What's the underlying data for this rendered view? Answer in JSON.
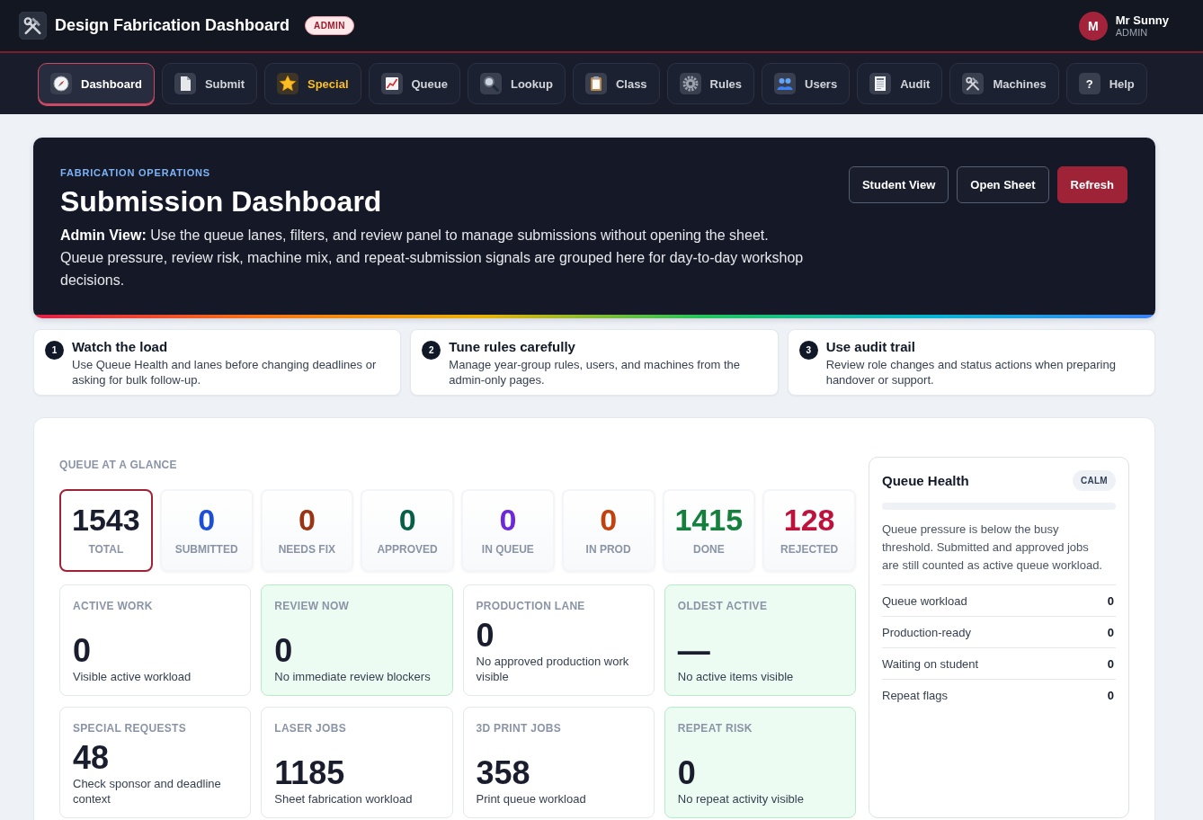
{
  "header": {
    "title": "Design Fabrication Dashboard",
    "badge": "ADMIN",
    "user": {
      "initial": "M",
      "name": "Mr Sunny",
      "role": "ADMIN"
    }
  },
  "nav": [
    {
      "label": "Dashboard",
      "selected": true,
      "highlighted": false
    },
    {
      "label": "Submit",
      "selected": false,
      "highlighted": false
    },
    {
      "label": "Special",
      "selected": false,
      "highlighted": true
    },
    {
      "label": "Queue",
      "selected": false,
      "highlighted": false
    },
    {
      "label": "Lookup",
      "selected": false,
      "highlighted": false
    },
    {
      "label": "Class",
      "selected": false,
      "highlighted": false
    },
    {
      "label": "Rules",
      "selected": false,
      "highlighted": false
    },
    {
      "label": "Users",
      "selected": false,
      "highlighted": false
    },
    {
      "label": "Audit",
      "selected": false,
      "highlighted": false
    },
    {
      "label": "Machines",
      "selected": false,
      "highlighted": false
    },
    {
      "label": "Help",
      "selected": false,
      "highlighted": false,
      "icon_text": "?"
    }
  ],
  "hero": {
    "eyebrow": "FABRICATION OPERATIONS",
    "title": "Submission Dashboard",
    "description_lines": [
      "**Admin View:** Use the queue lanes, filters, and review panel to manage submissions without opening the sheet.",
      "Queue pressure, review risk, machine mix, and repeat-submission signals are grouped here for day-to-day workshop decisions."
    ],
    "buttons": [
      {
        "label": "Student View",
        "kind": "secondary"
      },
      {
        "label": "Open Sheet",
        "kind": "secondary"
      },
      {
        "label": "Refresh",
        "kind": "primary"
      }
    ]
  },
  "tips": [
    {
      "number": "1",
      "title": "Watch the load",
      "text": "Use Queue Health and lanes before changing deadlines or asking for bulk follow-up."
    },
    {
      "number": "2",
      "title": "Tune rules carefully",
      "text": "Manage year-group rules, users, and machines from the admin-only pages."
    },
    {
      "number": "3",
      "title": "Use audit trail",
      "text": "Review role changes and status actions when preparing handover or support."
    }
  ],
  "queue": {
    "heading": "QUEUE AT A GLANCE",
    "stats": [
      {
        "value": "1543",
        "label": "TOTAL",
        "color": "#1a1d2e",
        "selected": true
      },
      {
        "value": "0",
        "label": "SUBMITTED",
        "color": "#1d4ed8",
        "selected": false
      },
      {
        "value": "0",
        "label": "NEEDS FIX",
        "color": "#9a3412",
        "selected": false
      },
      {
        "value": "0",
        "label": "APPROVED",
        "color": "#065f46",
        "selected": false
      },
      {
        "value": "0",
        "label": "IN QUEUE",
        "color": "#6d28d9",
        "selected": false
      },
      {
        "value": "0",
        "label": "IN PROD",
        "color": "#c2410c",
        "selected": false
      },
      {
        "value": "1415",
        "label": "DONE",
        "color": "#15803d",
        "selected": false
      },
      {
        "value": "128",
        "label": "REJECTED",
        "color": "#be123c",
        "selected": false
      }
    ],
    "cards": [
      {
        "label": "ACTIVE WORK",
        "value": "0",
        "description": "Visible active workload",
        "highlighted": false
      },
      {
        "label": "REVIEW NOW",
        "value": "0",
        "description": "No immediate review blockers",
        "highlighted": true
      },
      {
        "label": "PRODUCTION LANE",
        "value": "0",
        "description": "No approved production work visible",
        "highlighted": false
      },
      {
        "label": "OLDEST ACTIVE",
        "value": "—",
        "description": "No active items visible",
        "highlighted": true
      },
      {
        "label": "SPECIAL REQUESTS",
        "value": "48",
        "description": "Check sponsor and deadline context",
        "highlighted": false
      },
      {
        "label": "LASER JOBS",
        "value": "1185",
        "description": "Sheet fabrication workload",
        "highlighted": false
      },
      {
        "label": "3D PRINT JOBS",
        "value": "358",
        "description": "Print queue workload",
        "highlighted": false
      },
      {
        "label": "REPEAT RISK",
        "value": "0",
        "description": "No repeat activity visible",
        "highlighted": true
      }
    ]
  },
  "queue_health": {
    "title": "Queue Health",
    "status": "CALM",
    "level": 0,
    "description": "Queue pressure is below the busy threshold. Submitted and approved jobs are still counted as active queue workload.",
    "rows": [
      {
        "label": "Queue workload",
        "value": "0"
      },
      {
        "label": "Production-ready",
        "value": "0"
      },
      {
        "label": "Waiting on student",
        "value": "0"
      },
      {
        "label": "Repeat flags",
        "value": "0"
      }
    ]
  }
}
